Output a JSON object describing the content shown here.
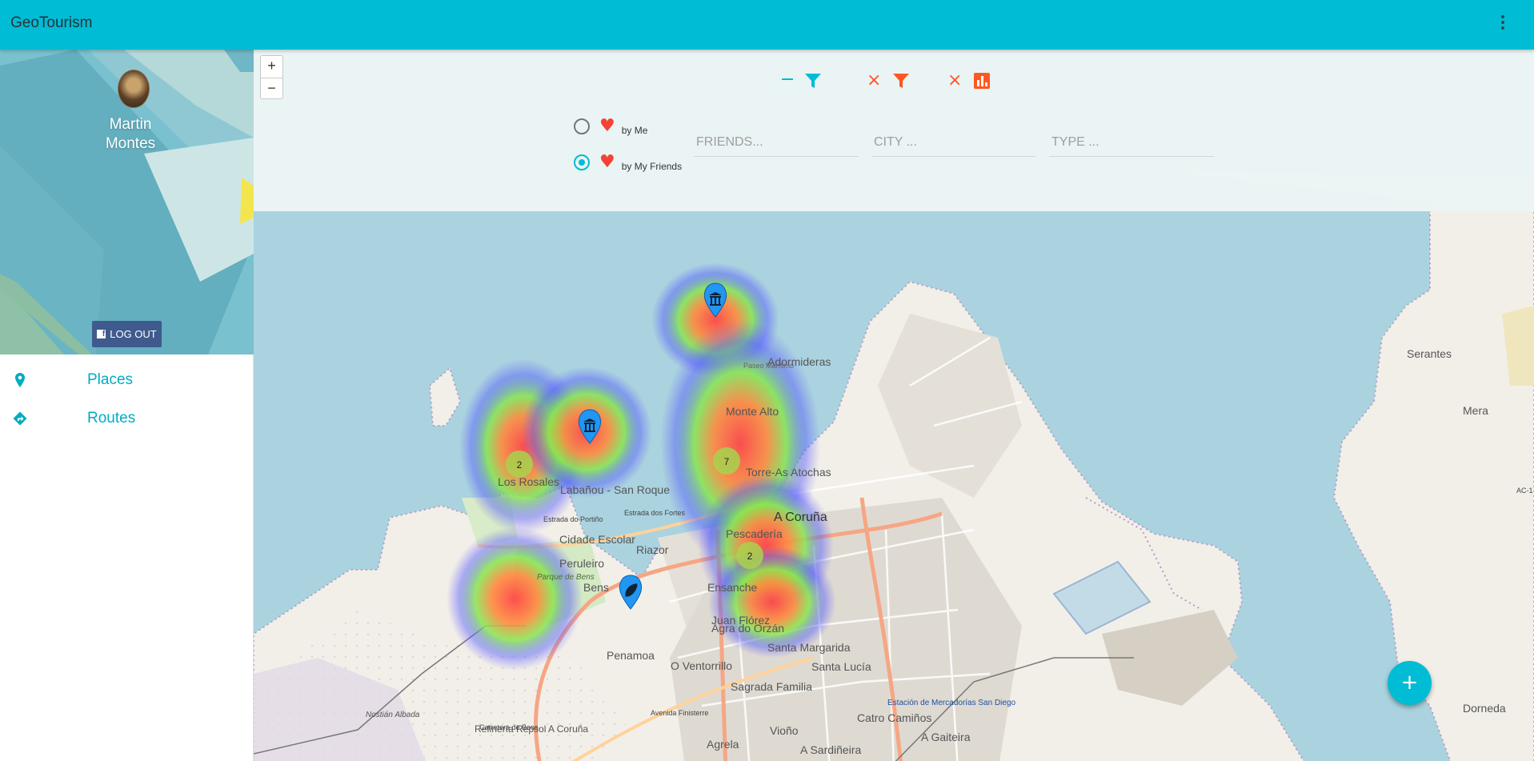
{
  "app": {
    "title": "GeoTourism"
  },
  "profile": {
    "name": "Martin Montes",
    "logout_label": "LOG OUT"
  },
  "nav": {
    "items": [
      {
        "label": "Places",
        "icon": "place-pin-icon"
      },
      {
        "label": "Routes",
        "icon": "directions-icon"
      }
    ]
  },
  "zoom": {
    "in": "+",
    "out": "−"
  },
  "filters": {
    "tool_icons": [
      "filter-collapse-icon",
      "filter-icon",
      "clear-filter-icon",
      "filter-icon",
      "clear-chart-icon",
      "chart-icon"
    ],
    "favorites": {
      "options": [
        {
          "label": "by Me",
          "checked": false
        },
        {
          "label": "by My Friends",
          "checked": true
        }
      ]
    },
    "friends_placeholder": "FRIENDS...",
    "city_placeholder": "CITY ...",
    "type_placeholder": "TYPE ..."
  },
  "map": {
    "place_labels": [
      "Adormideras",
      "Monte Alto",
      "Torre-As Atochas",
      "A Coruña",
      "Pescadería",
      "Ensanche",
      "Riazor",
      "Labañou - San Roque",
      "Los Rosales",
      "Cidade Escolar",
      "Peruleiro",
      "Bens",
      "Parque de Bens",
      "Penamoa",
      "O Ventorrillo",
      "Agra do Orzán",
      "Santa Margarida",
      "Juan Flórez",
      "Santa Lucía",
      "Sagrada Familia",
      "Catro Camiños",
      "Estación de Mercadorías San Diego",
      "Vioño",
      "A Sardiñeira",
      "A Gaiteira",
      "Agrela",
      "Refinería Repsol A Coruña",
      "Nostián Albada",
      "Serantes",
      "Mera",
      "Dorneda",
      "Paseo Marítimo",
      "Estrada do Portiño",
      "Estrada dos Fortes",
      "Avenida Finisterre",
      "Carretera de Bens",
      "AC-1"
    ],
    "clusters": [
      "2",
      "7",
      "2"
    ],
    "markers": [
      "museum-marker-icon",
      "museum-marker-icon",
      "leaf-marker-icon"
    ]
  },
  "fab": {
    "label": "+"
  },
  "colors": {
    "primary": "#00bcd4",
    "accent": "#ff5722",
    "heart": "#f44336"
  }
}
